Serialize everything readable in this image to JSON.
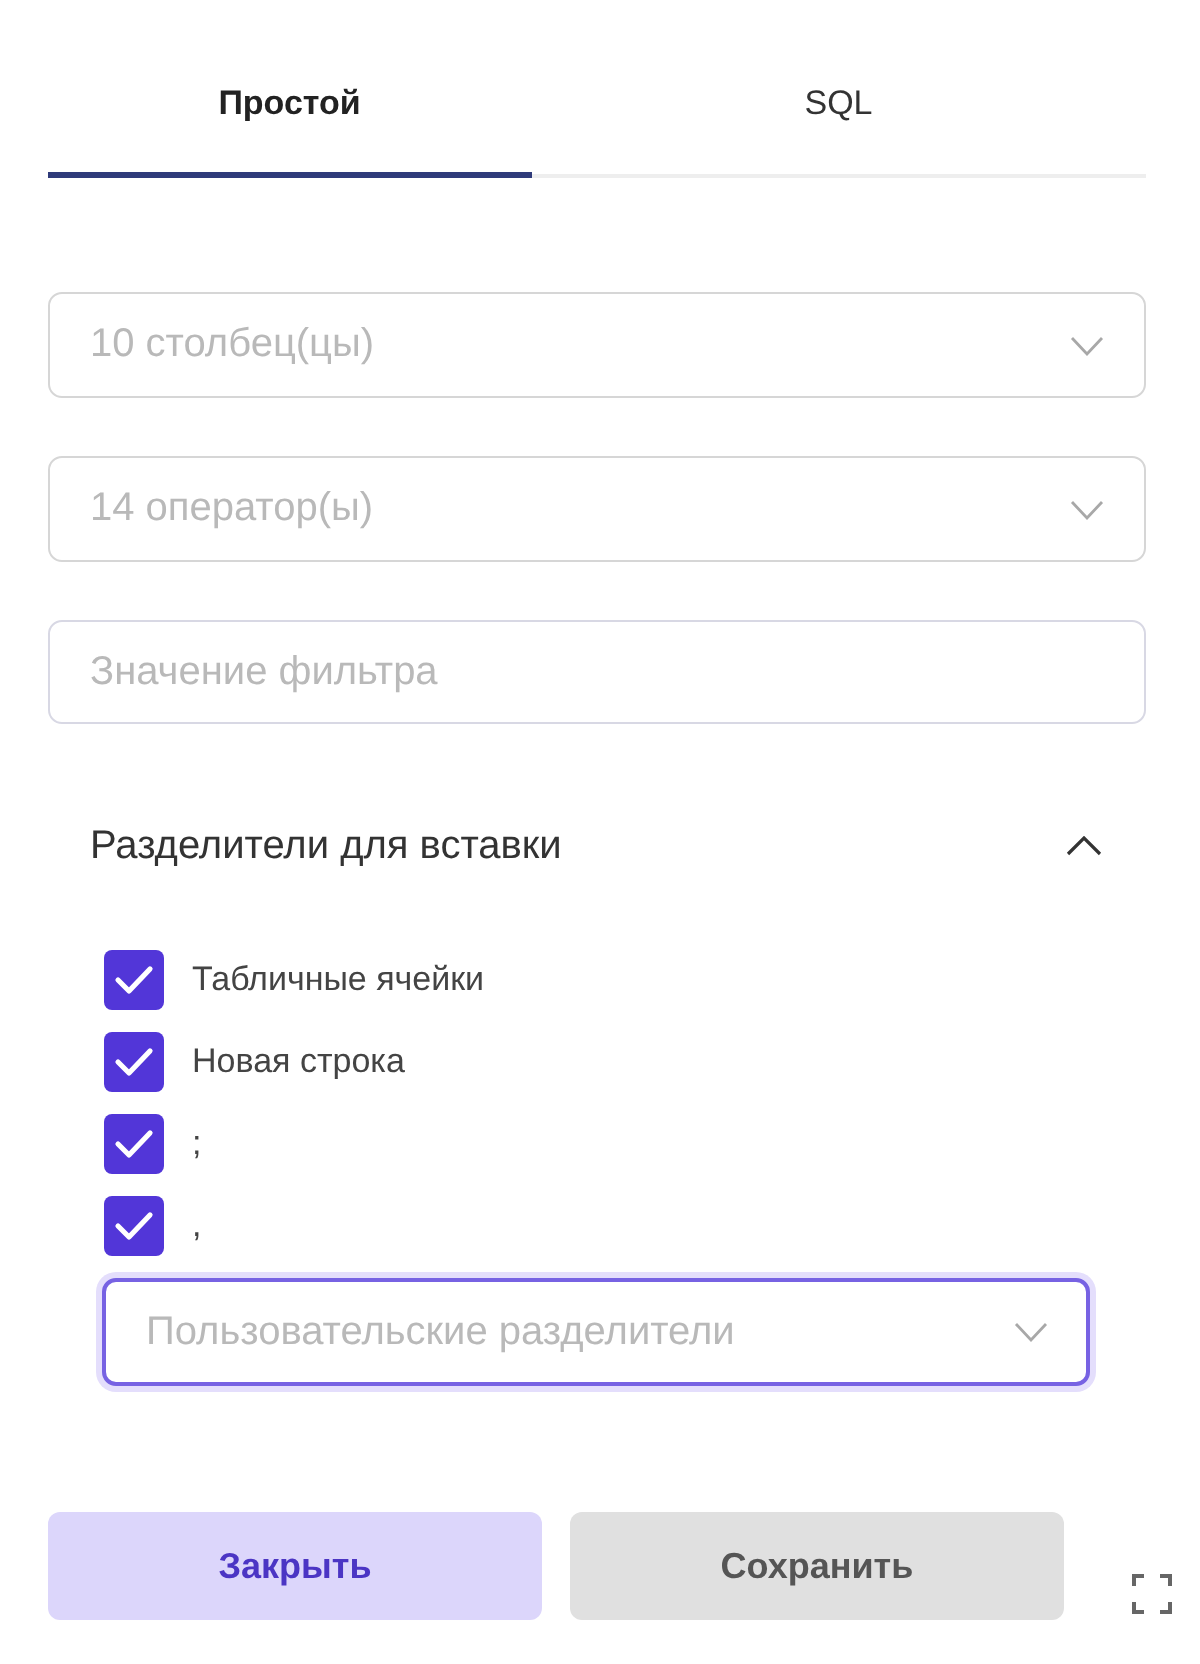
{
  "tabs": [
    {
      "label": "Простой",
      "selected": true
    },
    {
      "label": "SQL",
      "selected": false
    }
  ],
  "filters": [
    {
      "kind": "select",
      "placeholder": "10 столбец(цы)"
    },
    {
      "kind": "select",
      "placeholder": "14 оператор(ы)"
    },
    {
      "kind": "input",
      "placeholder": "Значение фильтра"
    }
  ],
  "section": {
    "title": "Разделители для вставки",
    "expanded": true,
    "separators": [
      {
        "label": "Табличные ячейки",
        "checked": true
      },
      {
        "label": "Новая строка",
        "checked": true
      },
      {
        "label": ";",
        "checked": true
      },
      {
        "label": ",",
        "checked": true
      }
    ],
    "custom_select": {
      "placeholder": "Пользовательские разделители",
      "focused": true
    }
  },
  "buttons": [
    {
      "label": "Закрыть",
      "kind": "primary"
    },
    {
      "label": "Сохранить",
      "kind": "secondary"
    }
  ]
}
